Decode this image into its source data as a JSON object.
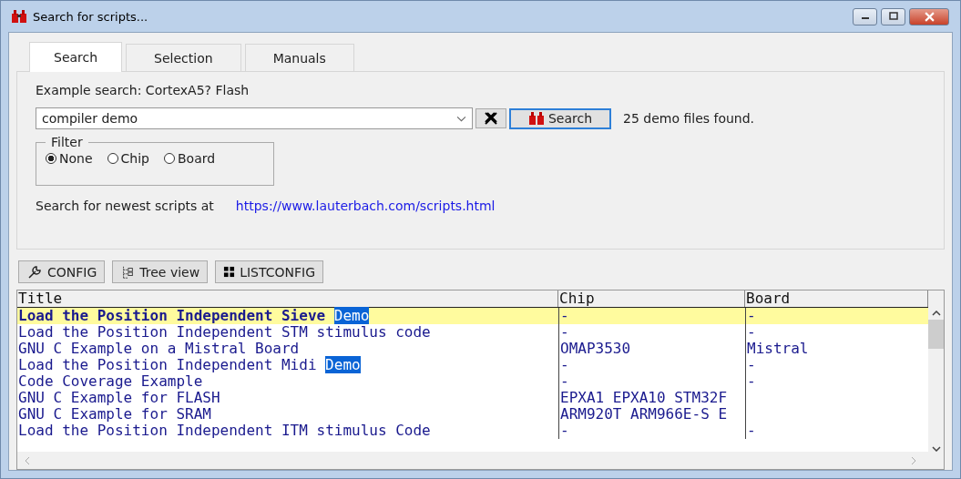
{
  "window": {
    "title": "Search for scripts..."
  },
  "tabs": [
    {
      "label": "Search",
      "selected": true
    },
    {
      "label": "Selection",
      "selected": false
    },
    {
      "label": "Manuals",
      "selected": false
    }
  ],
  "example": "Example search: CortexA5? Flash",
  "search": {
    "value": "compiler demo",
    "button": "Search",
    "result": "25 demo files found."
  },
  "filter": {
    "legend": "Filter",
    "options": [
      {
        "label": "None",
        "selected": true
      },
      {
        "label": "Chip",
        "selected": false
      },
      {
        "label": "Board",
        "selected": false
      }
    ]
  },
  "newest": {
    "label": "Search for newest scripts at",
    "link": "https://www.lauterbach.com/scripts.html"
  },
  "toolbar": [
    {
      "kind": "wrench",
      "label": "CONFIG"
    },
    {
      "kind": "tree",
      "label": "Tree view"
    },
    {
      "kind": "grid",
      "label": "LISTCONFIG"
    }
  ],
  "table": {
    "columns": [
      "Title",
      "Chip",
      "Board"
    ],
    "rows": [
      {
        "title": "Load the Position Independent Sieve",
        "match": "Demo",
        "chip": "-",
        "board": "-",
        "selected": true
      },
      {
        "title": "Load the Position Independent STM stimulus code",
        "chip": "-",
        "board": "-",
        "selected": false
      },
      {
        "title": "GNU C Example on a Mistral Board",
        "chip": "OMAP3530",
        "board": "Mistral",
        "selected": false
      },
      {
        "title": "Load the Position Independent Midi",
        "match": "Demo",
        "chip": "-",
        "board": "-",
        "selected": false
      },
      {
        "title": "Code Coverage Example",
        "chip": "-",
        "board": "-",
        "selected": false
      },
      {
        "title": "GNU C Example for FLASH",
        "chip": "EPXA1 EPXA10 STM32F",
        "selected": false
      },
      {
        "title": "GNU C Example for SRAM",
        "chip": "ARM920T ARM966E-S E",
        "selected": false
      },
      {
        "title": "Load the Position Independent ITM stimulus Code",
        "chip": "-",
        "board": "-",
        "selected": false
      }
    ]
  }
}
